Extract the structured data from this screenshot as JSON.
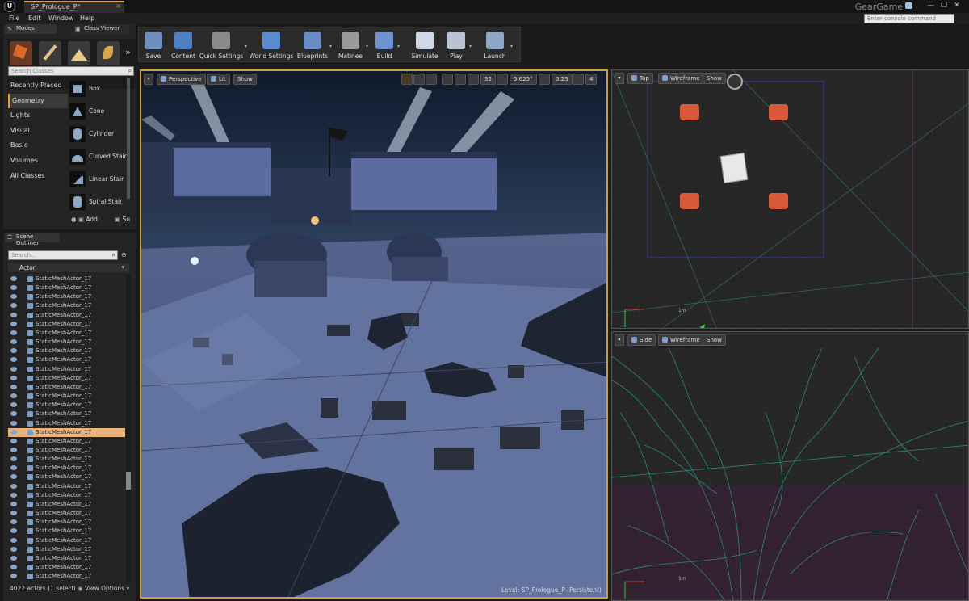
{
  "window": {
    "tab_title": "SP_Prologue_P*",
    "project": "GearGame",
    "min": "—",
    "max": "❐",
    "close": "✕"
  },
  "menu": [
    "File",
    "Edit",
    "Window",
    "Help"
  ],
  "console": {
    "placeholder": "Enter console command"
  },
  "modes": {
    "tab_label": "Modes",
    "class_viewer_tab": "Class Viewer",
    "more": "»",
    "search_placeholder": "Search Classes",
    "categories": [
      "Recently Placed",
      "Geometry",
      "Lights",
      "Visual",
      "Basic",
      "Volumes",
      "All Classes"
    ],
    "active_category": "Geometry",
    "items": [
      "Box",
      "Cone",
      "Cylinder",
      "Curved Stair",
      "Linear Stair",
      "Spiral Stair"
    ],
    "add_label": "Add",
    "sub_label": "Su"
  },
  "outliner": {
    "tab_label": "Scene Outliner",
    "search_placeholder": "Search...",
    "column": "Actor",
    "row_name": "StaticMeshActor_17",
    "row_count": 34,
    "selected_index": 17,
    "count_text": "4022 actors (1 selecti",
    "view_options": "View Options"
  },
  "toolbar": [
    {
      "label": "Save",
      "icon": "save-icon",
      "color": "#6f8fc0"
    },
    {
      "label": "Content",
      "icon": "content-icon",
      "color": "#4f7fc4"
    },
    {
      "label": "Quick Settings",
      "icon": "gear-icon",
      "color": "#8a8a8a"
    },
    {
      "label": "World Settings",
      "icon": "globe-icon",
      "color": "#5a8ad0"
    },
    {
      "label": "Blueprints",
      "icon": "blueprint-icon",
      "color": "#6a8cc4"
    },
    {
      "label": "Matinee",
      "icon": "clapper-icon",
      "color": "#9a9a9a"
    },
    {
      "label": "Build",
      "icon": "build-icon",
      "color": "#6f93d0"
    },
    {
      "label": "Simulate",
      "icon": "play-icon",
      "color": "#cfd8e6"
    },
    {
      "label": "Play",
      "icon": "gamepad-icon",
      "color": "#b8c4d4"
    },
    {
      "label": "Launch",
      "icon": "launch-icon",
      "color": "#8fa6c6"
    }
  ],
  "perspective": {
    "dropdown": "▾",
    "mode": "Perspective",
    "lit": "Lit",
    "show": "Show",
    "grid_snap": "32",
    "rot_snap": "5.625°",
    "scale_snap": "0.25",
    "cam_speed": "4",
    "level": "Level:  SP_Prologue_P (Persistent)"
  },
  "top_view": {
    "dropdown": "▾",
    "mode": "Top",
    "wireframe": "Wireframe",
    "show": "Show",
    "scale": "1m"
  },
  "side_view": {
    "dropdown": "▾",
    "mode": "Side",
    "wireframe": "Wireframe",
    "show": "Show",
    "scale": "1m"
  }
}
